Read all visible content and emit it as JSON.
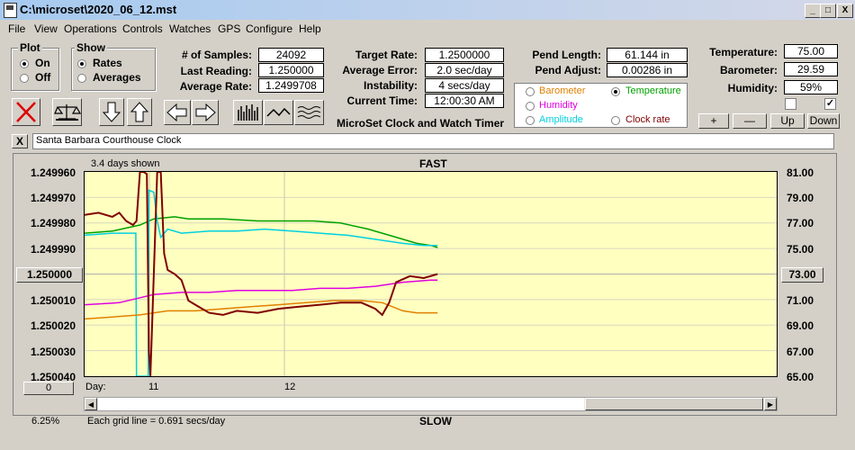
{
  "window": {
    "title": "C:\\microset\\2020_06_12.mst",
    "min": "_",
    "max": "□",
    "close": "X"
  },
  "menu": [
    "File",
    "View",
    "Operations",
    "Controls",
    "Watches",
    "GPS",
    "Configure",
    "Help"
  ],
  "plot_group": {
    "title": "Plot",
    "on": "On",
    "off": "Off",
    "selected": "On"
  },
  "show_group": {
    "title": "Show",
    "rates": "Rates",
    "averages": "Averages",
    "selected": "Rates"
  },
  "stats": {
    "samples_label": "# of Samples:",
    "samples": "24092",
    "last_label": "Last Reading:",
    "last": "1.250000",
    "avg_rate_label": "Average Rate:",
    "avg_rate": "1.2499708"
  },
  "rates": {
    "target_label": "Target Rate:",
    "target": "1.2500000",
    "avg_err_label": "Average Error:",
    "avg_err": "2.0 sec/day",
    "instab_label": "Instability:",
    "instab": "4 secs/day",
    "time_label": "Current Time:",
    "time": "12:00:30 AM"
  },
  "pend": {
    "length_label": "Pend Length:",
    "length": "61.144 in",
    "adjust_label": "Pend Adjust:",
    "adjust": "0.00286 in"
  },
  "sensor_select": {
    "barometer": "Barometer",
    "temperature": "Temperature",
    "humidity": "Humidity",
    "amplitude": "Amplitude",
    "clock_rate": "Clock rate",
    "selected": "Temperature",
    "colors": {
      "barometer": "#e08000",
      "temperature": "#00a000",
      "humidity": "#e000e0",
      "amplitude": "#00d0e0",
      "clock_rate": "#800000"
    }
  },
  "env": {
    "temp_label": "Temperature:",
    "temp": "75.00",
    "baro_label": "Barometer:",
    "baro": "29.59",
    "hum_label": "Humidity:",
    "hum": "59%",
    "chk1": false,
    "chk2": true
  },
  "adjust_buttons": {
    "plus": "+",
    "minus": "—",
    "up": "Up",
    "down": "Down"
  },
  "app_title": "MicroSet Clock and Watch Timer",
  "clock_name": "Santa Barbara Courthouse Clock",
  "close_x": "X",
  "chart": {
    "days_shown": "3.4 days shown",
    "fast": "FAST",
    "slow": "SLOW",
    "day_label": "Day:",
    "day_ticks": [
      "11",
      "12"
    ],
    "grid_note": "Each grid line = 0.691 secs/day",
    "left_button": "1.250000",
    "right_button": "73.00",
    "bottom_left_button": "0",
    "percent": "6.25%"
  },
  "chart_data": {
    "type": "line",
    "y_left_ticks": [
      "1.249960",
      "1.249970",
      "1.249980",
      "1.249990",
      "1.250000",
      "1.250010",
      "1.250020",
      "1.250030",
      "1.250040"
    ],
    "y_right_ticks": [
      "81.00",
      "79.00",
      "77.00",
      "75.00",
      "73.00",
      "71.00",
      "69.00",
      "67.00",
      "65.00"
    ],
    "x_range": [
      0,
      1
    ],
    "y_range": [
      0,
      1
    ],
    "series": [
      {
        "key": "temperature",
        "color": "#00a000",
        "points": [
          [
            0,
            0.7
          ],
          [
            0.04,
            0.71
          ],
          [
            0.08,
            0.74
          ],
          [
            0.1,
            0.77
          ],
          [
            0.13,
            0.78
          ],
          [
            0.15,
            0.77
          ],
          [
            0.2,
            0.77
          ],
          [
            0.25,
            0.76
          ],
          [
            0.28,
            0.76
          ],
          [
            0.33,
            0.76
          ],
          [
            0.37,
            0.75
          ],
          [
            0.41,
            0.72
          ],
          [
            0.45,
            0.68
          ],
          [
            0.48,
            0.65
          ],
          [
            0.5,
            0.64
          ],
          [
            0.51,
            0.63
          ]
        ]
      },
      {
        "key": "amplitude",
        "color": "#00d0e0",
        "points": [
          [
            0,
            0.69
          ],
          [
            0.04,
            0.7
          ],
          [
            0.07,
            0.7
          ],
          [
            0.074,
            0.7
          ],
          [
            0.075,
            0.0
          ],
          [
            0.092,
            0.0
          ],
          [
            0.093,
            0.91
          ],
          [
            0.1,
            0.9
          ],
          [
            0.105,
            0.76
          ],
          [
            0.11,
            0.68
          ],
          [
            0.12,
            0.72
          ],
          [
            0.14,
            0.7
          ],
          [
            0.18,
            0.71
          ],
          [
            0.22,
            0.71
          ],
          [
            0.26,
            0.72
          ],
          [
            0.3,
            0.71
          ],
          [
            0.34,
            0.7
          ],
          [
            0.38,
            0.69
          ],
          [
            0.42,
            0.67
          ],
          [
            0.46,
            0.65
          ],
          [
            0.49,
            0.64
          ],
          [
            0.51,
            0.64
          ]
        ]
      },
      {
        "key": "humidity",
        "color": "#e000e0",
        "points": [
          [
            0,
            0.35
          ],
          [
            0.05,
            0.36
          ],
          [
            0.1,
            0.4
          ],
          [
            0.14,
            0.41
          ],
          [
            0.18,
            0.41
          ],
          [
            0.22,
            0.42
          ],
          [
            0.26,
            0.42
          ],
          [
            0.3,
            0.42
          ],
          [
            0.34,
            0.43
          ],
          [
            0.38,
            0.43
          ],
          [
            0.42,
            0.44
          ],
          [
            0.46,
            0.46
          ],
          [
            0.5,
            0.47
          ],
          [
            0.51,
            0.47
          ]
        ]
      },
      {
        "key": "barometer",
        "color": "#e08000",
        "points": [
          [
            0,
            0.28
          ],
          [
            0.04,
            0.29
          ],
          [
            0.08,
            0.3
          ],
          [
            0.1,
            0.31
          ],
          [
            0.12,
            0.32
          ],
          [
            0.16,
            0.32
          ],
          [
            0.2,
            0.33
          ],
          [
            0.24,
            0.34
          ],
          [
            0.28,
            0.35
          ],
          [
            0.32,
            0.36
          ],
          [
            0.36,
            0.37
          ],
          [
            0.4,
            0.37
          ],
          [
            0.43,
            0.36
          ],
          [
            0.46,
            0.32
          ],
          [
            0.48,
            0.31
          ],
          [
            0.51,
            0.31
          ]
        ]
      },
      {
        "key": "clock_rate",
        "color": "#800000",
        "points": [
          [
            0,
            0.79
          ],
          [
            0.02,
            0.8
          ],
          [
            0.04,
            0.78
          ],
          [
            0.05,
            0.8
          ],
          [
            0.06,
            0.76
          ],
          [
            0.07,
            0.74
          ],
          [
            0.075,
            0.76
          ],
          [
            0.08,
            1.0
          ],
          [
            0.085,
            1.0
          ],
          [
            0.09,
            0.99
          ],
          [
            0.093,
            0.12
          ],
          [
            0.095,
            0.0
          ],
          [
            0.1,
            0.5
          ],
          [
            0.105,
            1.0
          ],
          [
            0.11,
            1.0
          ],
          [
            0.115,
            0.6
          ],
          [
            0.12,
            0.52
          ],
          [
            0.13,
            0.5
          ],
          [
            0.14,
            0.47
          ],
          [
            0.15,
            0.37
          ],
          [
            0.16,
            0.35
          ],
          [
            0.17,
            0.33
          ],
          [
            0.18,
            0.31
          ],
          [
            0.2,
            0.3
          ],
          [
            0.22,
            0.32
          ],
          [
            0.25,
            0.31
          ],
          [
            0.28,
            0.33
          ],
          [
            0.31,
            0.34
          ],
          [
            0.34,
            0.35
          ],
          [
            0.37,
            0.36
          ],
          [
            0.4,
            0.36
          ],
          [
            0.42,
            0.33
          ],
          [
            0.43,
            0.3
          ],
          [
            0.44,
            0.36
          ],
          [
            0.45,
            0.46
          ],
          [
            0.47,
            0.49
          ],
          [
            0.49,
            0.48
          ],
          [
            0.51,
            0.5
          ]
        ]
      }
    ]
  }
}
